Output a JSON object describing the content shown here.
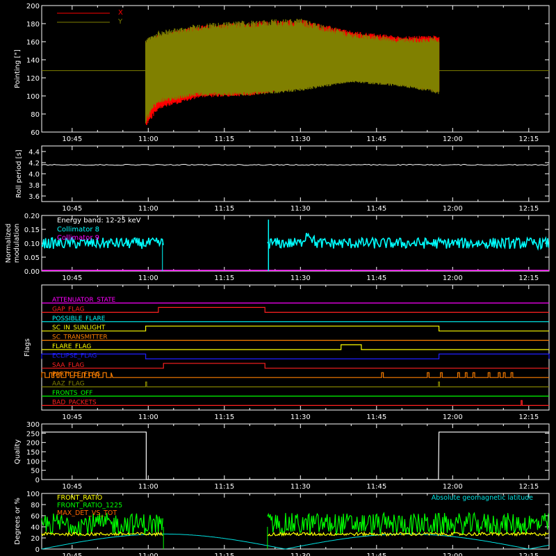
{
  "colors": {
    "background": "#000000",
    "axes": "#ffffff",
    "x_series": "#ff0000",
    "y_series": "#808000",
    "collimator8": "#00ffff",
    "collimator9": "#ff00ff",
    "front_ratio": "#ffff00",
    "front_ratio_1225": "#00ff00",
    "max_det_vs_tot": "#ff6600",
    "geomag": "#00e0e0"
  },
  "chart_data": [
    {
      "id": "pointing",
      "type": "line",
      "ylabel": "Pointing [\"]",
      "ylim": [
        60,
        200
      ],
      "yticks": [
        "60",
        "80",
        "100",
        "120",
        "140",
        "160",
        "180",
        "200"
      ],
      "xlim_min": [
        639,
        739
      ],
      "xticks": [
        "10:45",
        "11:00",
        "11:15",
        "11:30",
        "11:45",
        "12:00",
        "12:15"
      ],
      "legend": [
        {
          "name": "X",
          "color": "#ff0000"
        },
        {
          "name": "Y",
          "color": "#808000"
        }
      ],
      "legend_position": "top-left",
      "baseline_y": 128,
      "data_span_min": [
        659.5,
        717.3
      ],
      "y_band": {
        "time_min": [
          659.5,
          662,
          670,
          680,
          690,
          700,
          710,
          717.3
        ],
        "y_max": [
          163,
          172,
          180,
          184,
          186,
          170,
          164,
          165
        ],
        "y_min": [
          70,
          92,
          100,
          100,
          105,
          115,
          110,
          102
        ],
        "x_max": [
          160,
          168,
          178,
          182,
          185,
          172,
          166,
          167
        ],
        "x_min": [
          65,
          85,
          98,
          100,
          108,
          117,
          112,
          104
        ]
      }
    },
    {
      "id": "roll",
      "type": "line",
      "ylabel": "Roll period [s]",
      "ylim": [
        3.5,
        4.5
      ],
      "yticks": [
        "3.6",
        "3.8",
        "4.0",
        "4.2",
        "4.4"
      ],
      "xticks": [
        "10:45",
        "11:00",
        "11:15",
        "11:30",
        "11:45",
        "12:00",
        "12:15"
      ],
      "value": 4.16
    },
    {
      "id": "modulation",
      "type": "line",
      "ylabel_lines": [
        "Normalized",
        "modulation"
      ],
      "ylim": [
        0,
        0.2
      ],
      "yticks": [
        "0.00",
        "0.05",
        "0.10",
        "0.15",
        "0.20"
      ],
      "xticks": [
        "10:45",
        "11:00",
        "11:15",
        "11:30",
        "11:45",
        "12:00",
        "12:15"
      ],
      "annotation": "Energy band: 12-25 keV",
      "legend": [
        {
          "name": "Collimator 8",
          "color": "#00ffff"
        },
        {
          "name": "Collimator 9",
          "color": "#ff00ff"
        }
      ],
      "series_segments_min": [
        [
          639,
          663
        ],
        [
          683.5,
          739
        ]
      ],
      "mean": 0.1,
      "spikes": [
        {
          "t": 662.8,
          "v": 0.0
        },
        {
          "t": 683.7,
          "v": 0.185
        },
        {
          "t": 691.5,
          "v": 0.16
        }
      ]
    },
    {
      "id": "flags",
      "type": "table",
      "ylabel": "Flags",
      "xticks": [
        "10:45",
        "11:00",
        "11:15",
        "11:30",
        "11:45",
        "12:00",
        "12:15"
      ],
      "rows": [
        {
          "name": "ATTENUATOR_STATE",
          "color": "#ff00ff",
          "highs": []
        },
        {
          "name": "GAP_FLAG",
          "color": "#ff2020",
          "highs": [
            [
              662,
              683
            ]
          ]
        },
        {
          "name": "POSSIBLE_FLARE",
          "color": "#00ffff",
          "highs": []
        },
        {
          "name": "SC_IN_SUNLIGHT",
          "color": "#ffff00",
          "highs": [
            [
              659.5,
              717.3
            ]
          ]
        },
        {
          "name": "SC_TRANSMITTER",
          "color": "#ff8000",
          "highs": []
        },
        {
          "name": "FLARE_FLAG",
          "color": "#ffff00",
          "highs": [
            [
              698,
              702
            ]
          ]
        },
        {
          "name": "ECLIPSE_FLAG",
          "color": "#2020ff",
          "highs": [
            [
              639,
              659.5
            ],
            [
              717.3,
              739
            ]
          ]
        },
        {
          "name": "SAA_FLAG",
          "color": "#ff2020",
          "highs": [
            [
              663,
              683
            ]
          ]
        },
        {
          "name": "PARTICLE_FLAG",
          "color": "#ff8000",
          "highs": [
            [
              639,
              653
            ]
          ],
          "label_overlap": "IDPRITICLEIFLAG"
        },
        {
          "name": "AAZ_FLAG",
          "color": "#808000",
          "highs": [
            [
              659.5,
              659.7
            ],
            [
              717.2,
              717.4
            ]
          ]
        },
        {
          "name": "FRONTS_OFF",
          "color": "#00ff00",
          "highs": []
        },
        {
          "name": "BAD_PACKETS",
          "color": "#ff2020",
          "highs": [
            [
              733.5,
              733.6
            ]
          ]
        }
      ]
    },
    {
      "id": "quality",
      "type": "line",
      "ylabel": "Quality",
      "ylim": [
        0,
        300
      ],
      "yticks": [
        "0",
        "50",
        "100",
        "150",
        "200",
        "250",
        "300"
      ],
      "xticks": [
        "10:45",
        "11:00",
        "11:15",
        "11:30",
        "11:45",
        "12:00",
        "12:15"
      ],
      "x": [
        639,
        659.6,
        659.6,
        717.2,
        717.2,
        717.3,
        739
      ],
      "values": [
        256,
        256,
        0,
        0,
        12,
        256,
        256
      ]
    },
    {
      "id": "ratios",
      "type": "line",
      "ylabel": "Degrees or %",
      "ylim": [
        0,
        100
      ],
      "yticks": [
        "0",
        "20",
        "40",
        "60",
        "80",
        "100"
      ],
      "xticks": [
        "10:45",
        "11:00",
        "11:15",
        "11:30",
        "11:45",
        "12:00",
        "12:15"
      ],
      "legend": [
        {
          "name": "FRONT_RATIO",
          "color": "#ffff00"
        },
        {
          "name": "FRONT_RATIO_1225",
          "color": "#00ff00"
        },
        {
          "name": "MAX_DET_VS_TOT",
          "color": "#ff6600"
        }
      ],
      "annotation": "Absolute geomagnetic latitude",
      "series_segments_min": [
        [
          639,
          663
        ],
        [
          683.5,
          739
        ]
      ],
      "green_mean": 45,
      "yellow_mean": 27,
      "geomag_peaks_min": [
        663,
        711,
        759
      ],
      "geomag_troughs_min": [
        639,
        687,
        735
      ],
      "geomag_peak": 27
    }
  ]
}
